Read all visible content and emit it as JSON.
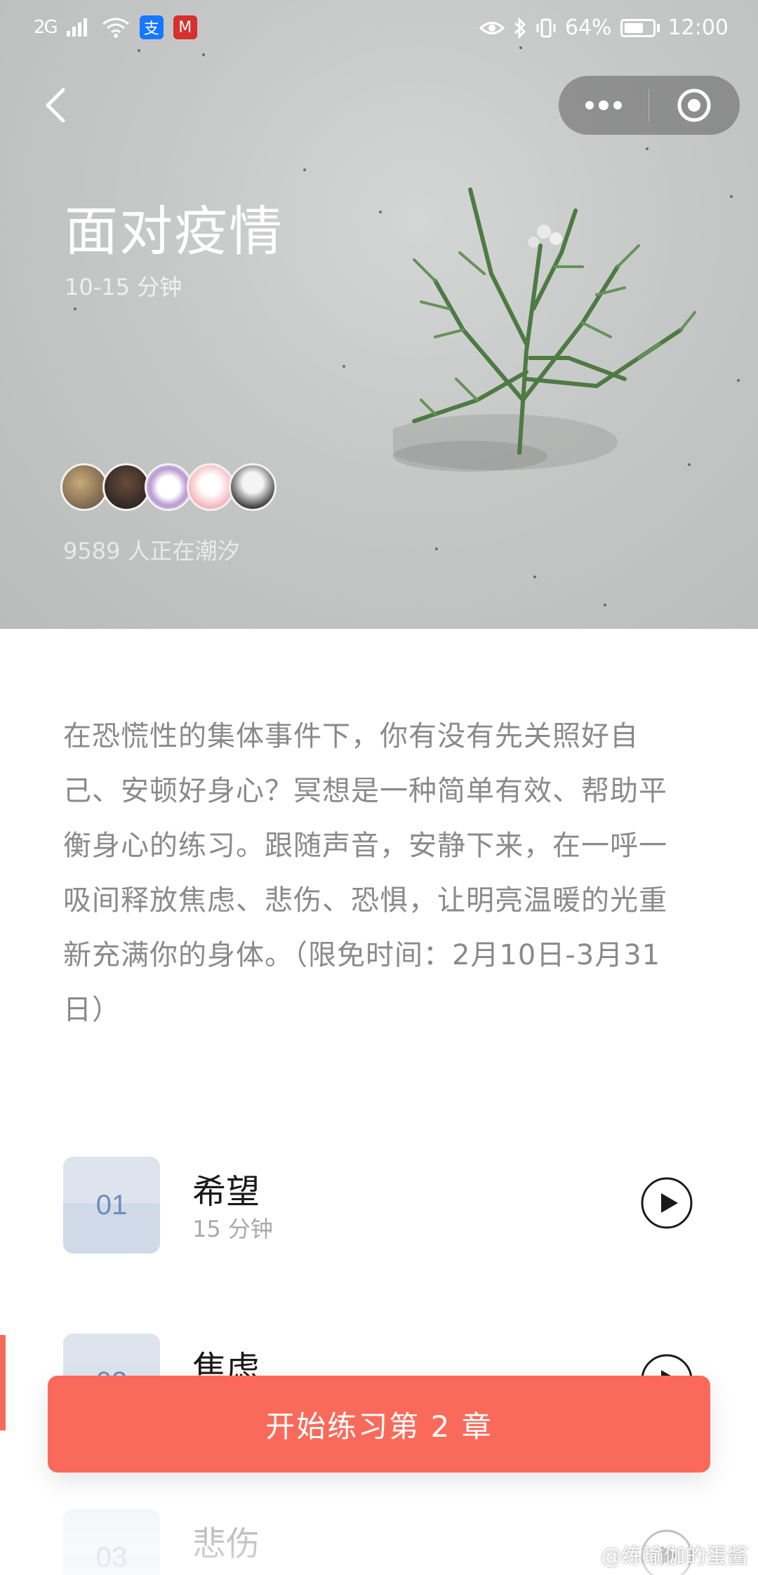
{
  "status_bar": {
    "signal": "2G",
    "battery": "64%",
    "time": "12:00",
    "apps": [
      "alipay-icon",
      "bank-icon"
    ]
  },
  "nav": {
    "back_icon": "chevron-left-icon",
    "more_icon": "more-dots-icon",
    "close_icon": "target-circle-icon"
  },
  "hero": {
    "title": "面对疫情",
    "duration": "10-15 分钟",
    "active_count": "9589 人正在潮汐"
  },
  "description": "在恐慌性的集体事件下，你有没有先关照好自己、安顿好身心？冥想是一种简单有效、帮助平衡身心的练习。跟随声音，安静下来，在一呼一吸间释放焦虑、悲伤、恐惧，让明亮温暖的光重新充满你的身体。（限免时间：2月10日-3月31日）",
  "chapters": [
    {
      "number": "01",
      "title": "希望",
      "duration": "15 分钟"
    },
    {
      "number": "02",
      "title": "焦虑",
      "duration": ""
    },
    {
      "number": "03",
      "title": "悲伤",
      "duration": ""
    }
  ],
  "cta": {
    "label": "开始练习第 2 章"
  },
  "watermark": "@练瑜伽的蛋酱",
  "colors": {
    "accent": "#f96a5a",
    "chapter_badge": "#dde4ee",
    "chapter_number": "#6f8cb8"
  }
}
